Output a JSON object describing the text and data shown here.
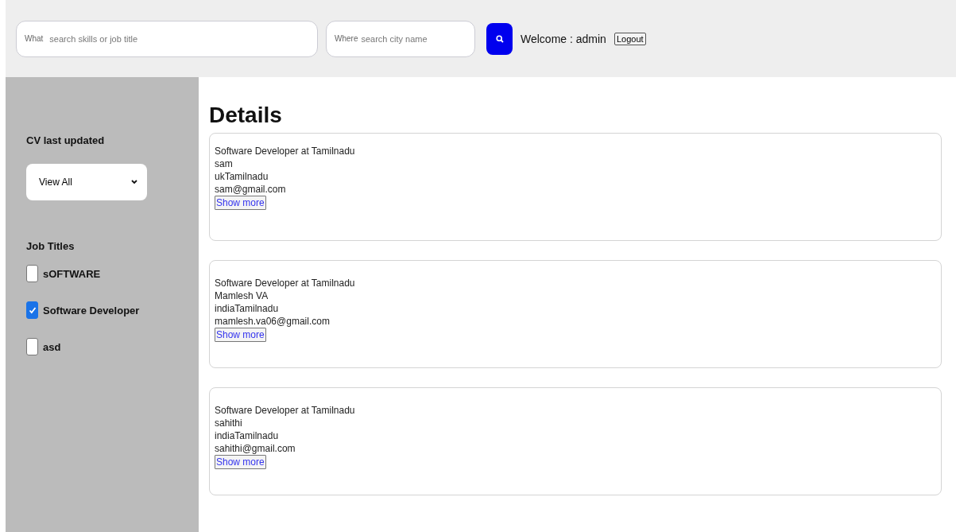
{
  "search": {
    "what_label": "What",
    "what_placeholder": "search skills or job title",
    "where_label": "Where",
    "where_placeholder": "search city name"
  },
  "welcome": "Welcome : admin",
  "logout": "Logout",
  "sidebar": {
    "cv_heading": "CV last updated",
    "cv_select": "View All",
    "job_heading": "Job Titles",
    "job_titles": [
      {
        "label": "sOFTWARE",
        "checked": false
      },
      {
        "label": "Software Developer",
        "checked": true
      },
      {
        "label": "asd",
        "checked": false
      }
    ]
  },
  "heading": "Details",
  "results": [
    {
      "title": "Software Developer at Tamilnadu",
      "name": "sam",
      "location": "ukTamilnadu",
      "email": "sam@gmail.com",
      "button": "Show more"
    },
    {
      "title": "Software Developer at Tamilnadu",
      "name": "Mamlesh VA",
      "location": "indiaTamilnadu",
      "email": "mamlesh.va06@gmail.com",
      "button": "Show more"
    },
    {
      "title": "Software Developer at Tamilnadu",
      "name": "sahithi",
      "location": "indiaTamilnadu",
      "email": "sahithi@gmail.com",
      "button": "Show more"
    }
  ]
}
